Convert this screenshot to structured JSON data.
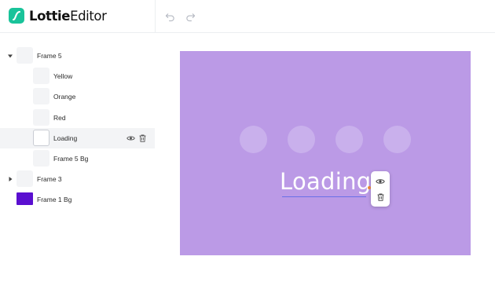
{
  "app": {
    "logo_bold": "Lottie",
    "logo_regular": "Editor",
    "brand_color": "#19c39a"
  },
  "toolbar": {
    "undo_icon": "undo-icon",
    "redo_icon": "redo-icon"
  },
  "layers": [
    {
      "label": "Frame 5",
      "depth": 0,
      "expanded": true,
      "thumb_color": "#f3f4f6"
    },
    {
      "label": "Yellow",
      "depth": 1,
      "thumb_color": "#f3f4f6"
    },
    {
      "label": "Orange",
      "depth": 1,
      "thumb_color": "#f3f4f6"
    },
    {
      "label": "Red",
      "depth": 1,
      "thumb_color": "#f3f4f6"
    },
    {
      "label": "Loading",
      "depth": 1,
      "selected": true,
      "thumb_color": "#ffffff",
      "actions": [
        "eye-icon",
        "trash-icon"
      ]
    },
    {
      "label": "Frame 5 Bg",
      "depth": 1,
      "thumb_color": "#f3f4f6"
    },
    {
      "label": "Frame 3",
      "depth": 0,
      "expanded": false,
      "thumb_color": "#f3f4f6"
    },
    {
      "label": "Frame 1 Bg",
      "depth": 0,
      "thumb_color": "#5a0fd0"
    }
  ],
  "canvas": {
    "background_color": "#bb9ae6",
    "dot_color": "#c9b0ec",
    "dots": 4,
    "text": "Loading",
    "text_color": "#ffffff",
    "selection_color": "#5a67e8",
    "handle_color": "#f08a3c",
    "toolbar_icons": [
      "eye-icon",
      "trash-icon"
    ]
  }
}
